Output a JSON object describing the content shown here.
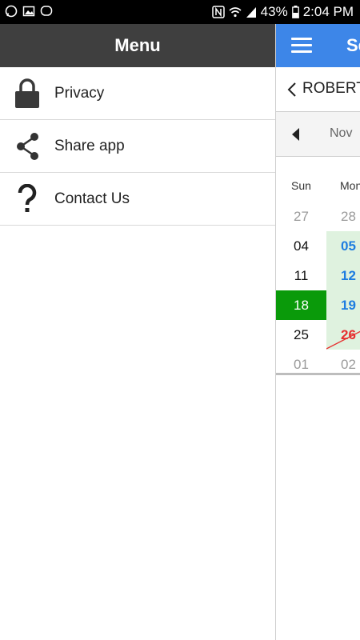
{
  "status_bar": {
    "time": "2:04 PM",
    "battery": "43%",
    "left_icons": [
      "whatsapp-icon",
      "image-icon",
      "chat-bubble-icon"
    ],
    "right_icons": [
      "nfc-icon",
      "wifi-icon",
      "signal-icon",
      "battery-icon"
    ]
  },
  "drawer": {
    "title": "Menu",
    "items": [
      {
        "label": "Privacy",
        "icon": "lock-icon"
      },
      {
        "label": "Share app",
        "icon": "share-icon"
      },
      {
        "label": "Contact Us",
        "icon": "question-icon"
      }
    ]
  },
  "main": {
    "appbar_title": "Se",
    "back_name": "ROBERT",
    "month": "Nov",
    "weekday_headers": [
      "Sun",
      "Mon"
    ],
    "rows": [
      {
        "sun": "27",
        "mon": "28"
      },
      {
        "sun": "04",
        "mon": "05"
      },
      {
        "sun": "11",
        "mon": "12"
      },
      {
        "sun": "18",
        "mon": "19"
      },
      {
        "sun": "25",
        "mon": "26"
      },
      {
        "sun": "01",
        "mon": "02"
      }
    ]
  },
  "colors": {
    "appbar": "#3d86e8",
    "drawer_header": "#3f3f3f",
    "today": "#0a9a0a",
    "highlight": "#dff2df",
    "blue_date": "#1e7de0",
    "red_date": "#e63030"
  }
}
